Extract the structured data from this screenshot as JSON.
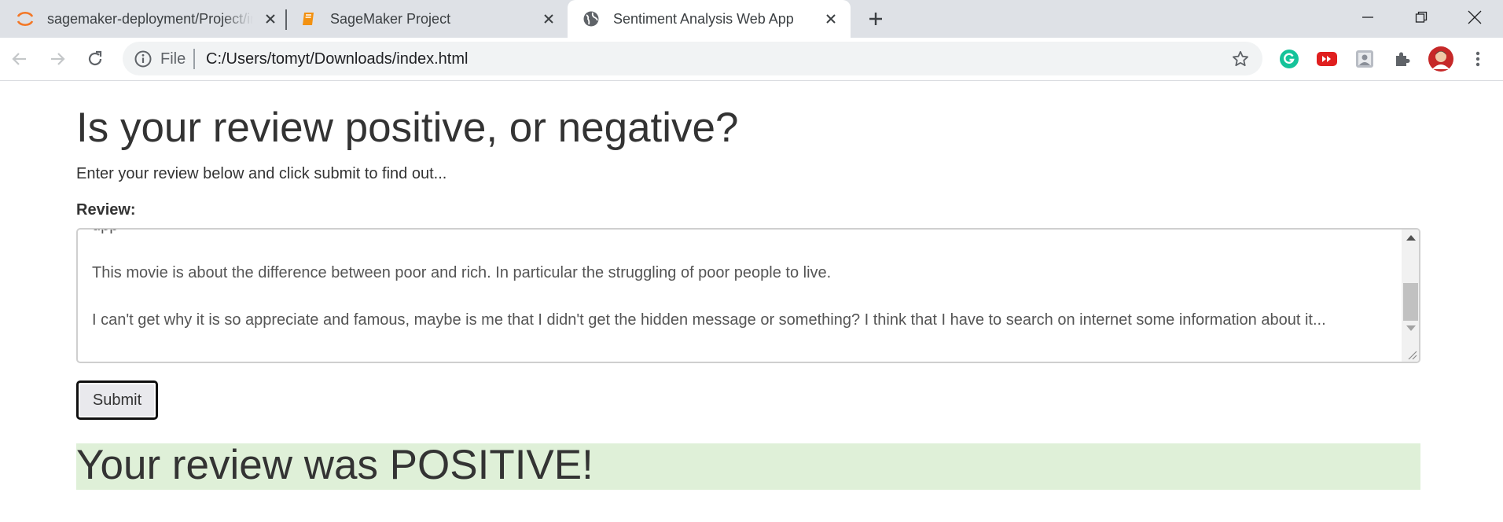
{
  "browser": {
    "tabs": [
      {
        "title": "sagemaker-deployment/Project/index.html",
        "icon": "jupyter-icon"
      },
      {
        "title": "SageMaker Project",
        "icon": "notebook-icon"
      },
      {
        "title": "Sentiment Analysis Web App",
        "icon": "globe-icon"
      }
    ],
    "address_scheme": "File",
    "address_url": "C:/Users/tomyt/Downloads/index.html"
  },
  "page": {
    "heading": "Is your review positive, or negative?",
    "lede": "Enter your review below and click submit to find out...",
    "review_label": "Review:",
    "review_text": {
      "partial_line": "upp",
      "line1": "This movie is about the difference between poor and rich. In particular the struggling of poor people to live.",
      "line2": "I can't get why it is so appreciate and famous, maybe is me that I didn't get the hidden message or something? I think that I have to search on internet some information about it..."
    },
    "submit_label": "Submit",
    "result_text": "Your review was POSITIVE!"
  },
  "colors": {
    "result_background": "#dff0d8",
    "tabstrip": "#dee1e6",
    "text": "#333333"
  }
}
